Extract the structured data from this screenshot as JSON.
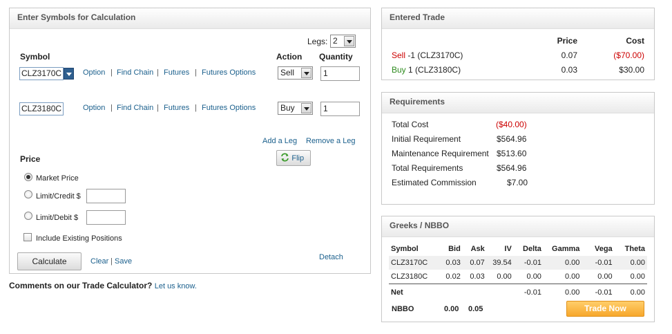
{
  "calc": {
    "title": "Enter Symbols for Calculation",
    "legs_label": "Legs:",
    "legs_value": "2",
    "col_symbol": "Symbol",
    "col_action": "Action",
    "col_quantity": "Quantity",
    "rows": [
      {
        "symbol": "CLZ3170C",
        "action": "Sell",
        "quantity": "1"
      },
      {
        "symbol": "CLZ3180C",
        "action": "Buy",
        "quantity": "1"
      }
    ],
    "links": {
      "option": "Option",
      "find_chain": "Find Chain",
      "futures": "Futures",
      "futures_options": "Futures Options",
      "sep": "|"
    },
    "add_leg": "Add a Leg",
    "remove_leg": "Remove a Leg",
    "flip": "Flip",
    "price_title": "Price",
    "market_price": "Market Price",
    "limit_credit": "Limit/Credit $",
    "limit_debit": "Limit/Debit $",
    "include_existing": "Include Existing Positions",
    "calculate": "Calculate",
    "clear": "Clear",
    "save": "Save",
    "detach": "Detach"
  },
  "comments": {
    "text": "Comments on our Trade Calculator?",
    "link": "Let us know."
  },
  "entered": {
    "title": "Entered Trade",
    "col_price": "Price",
    "col_cost": "Cost",
    "trades": [
      {
        "action": "Sell",
        "detail": "-1 (CLZ3170C)",
        "price": "0.07",
        "cost": "($70.00)"
      },
      {
        "action": "Buy",
        "detail": "1 (CLZ3180C)",
        "price": "0.03",
        "cost": "$30.00"
      }
    ]
  },
  "requirements": {
    "title": "Requirements",
    "rows": [
      {
        "label": "Total Cost",
        "value": "($40.00)"
      },
      {
        "label": "Initial Requirement",
        "value": "$564.96"
      },
      {
        "label": "Maintenance Requirement",
        "value": "$513.60"
      },
      {
        "label": "Total Requirements",
        "value": "$564.96"
      },
      {
        "label": "Estimated Commission",
        "value": "$7.00"
      }
    ]
  },
  "greeks": {
    "title": "Greeks / NBBO",
    "headers": [
      "Symbol",
      "Bid",
      "Ask",
      "IV",
      "Delta",
      "Gamma",
      "Vega",
      "Theta"
    ],
    "rows": [
      [
        "CLZ3170C",
        "0.03",
        "0.07",
        "39.54",
        "-0.01",
        "0.00",
        "-0.01",
        "0.00"
      ],
      [
        "CLZ3180C",
        "0.02",
        "0.03",
        "0.00",
        "0.00",
        "0.00",
        "0.00",
        "0.00"
      ]
    ],
    "net": {
      "label": "Net",
      "delta": "-0.01",
      "gamma": "0.00",
      "vega": "-0.01",
      "theta": "0.00"
    },
    "nbbo": {
      "label": "NBBO",
      "bid": "0.00",
      "ask": "0.05"
    },
    "trade_now": "Trade Now"
  },
  "colors": {
    "negative": "#cc0000",
    "buy": "#2e8b1f",
    "link": "#1a5f8c",
    "accent": "#f7a72b"
  },
  "icons": {
    "flip": "refresh-arrows-icon",
    "dropdown": "chevron-down-icon"
  }
}
